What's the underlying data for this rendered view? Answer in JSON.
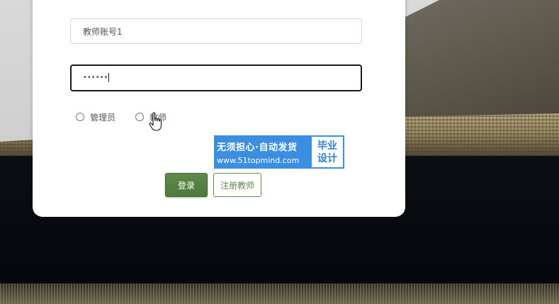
{
  "login_form": {
    "username_value": "教师账号1",
    "password_mask": "••••••",
    "roles": [
      {
        "label": "管理员",
        "selected": false
      },
      {
        "label": "教师",
        "selected": false
      }
    ],
    "login_button_label": "登录",
    "register_button_label": "注册教师"
  },
  "watermark": {
    "line1": "无须担心·自动发货",
    "line2": "www.51topmind.com",
    "badge_line1": "毕业",
    "badge_line2": "设计"
  },
  "cursor": {
    "icon": "hand-pointer-icon"
  },
  "colors": {
    "primary_green": "#4c7a3a",
    "watermark_blue": "#3b8ee0"
  }
}
